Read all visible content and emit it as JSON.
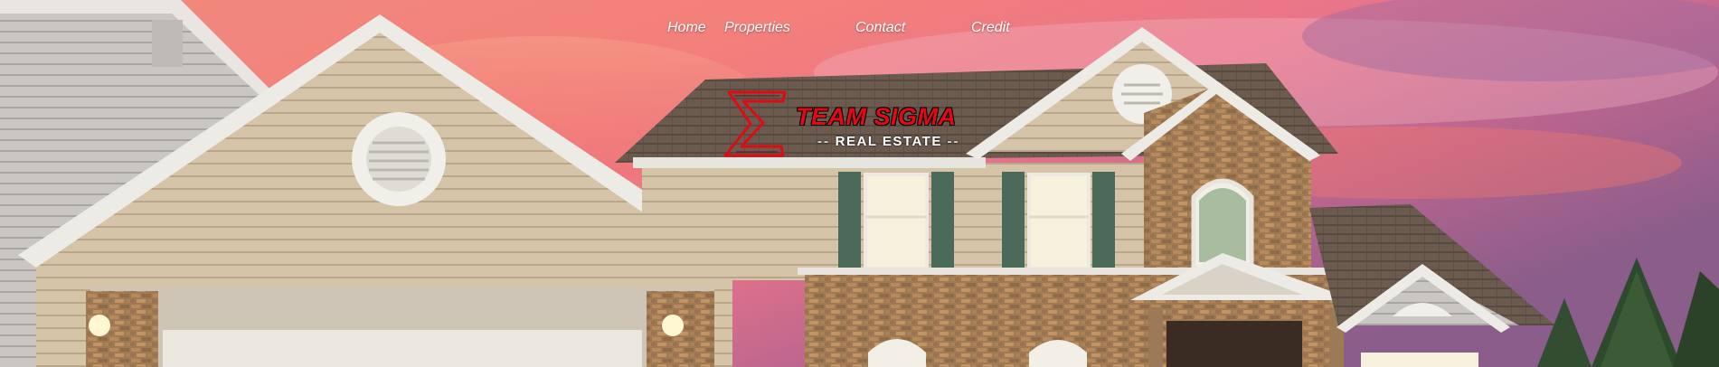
{
  "nav": {
    "items": [
      {
        "label": "Home"
      },
      {
        "label": "Properties"
      },
      {
        "label": "Contact"
      },
      {
        "label": "Credit"
      }
    ]
  },
  "logo": {
    "symbol": "Σ",
    "brand": "TEAM SIGMA",
    "dash_left": "--",
    "tagline": "REAL ESTATE",
    "dash_right": "--"
  },
  "colors": {
    "brand_red": "#e10a14",
    "nav_text": "#ffffff"
  }
}
